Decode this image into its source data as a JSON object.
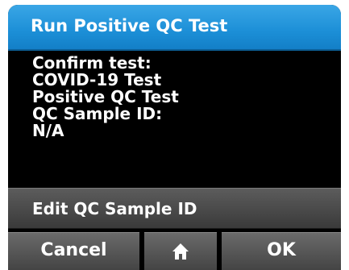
{
  "header": {
    "title": "Run Positive QC Test"
  },
  "confirmation": {
    "lines": [
      "Confirm test:",
      "COVID-19 Test",
      "Positive QC Test",
      "QC Sample ID:",
      "N/A"
    ]
  },
  "actions": {
    "edit_label": "Edit QC Sample ID",
    "cancel_label": "Cancel",
    "home_icon": "home-icon",
    "ok_label": "OK"
  },
  "colors": {
    "title_bar": "#1c8fd7",
    "background": "#000000",
    "button": "#555555",
    "text": "#ffffff"
  }
}
